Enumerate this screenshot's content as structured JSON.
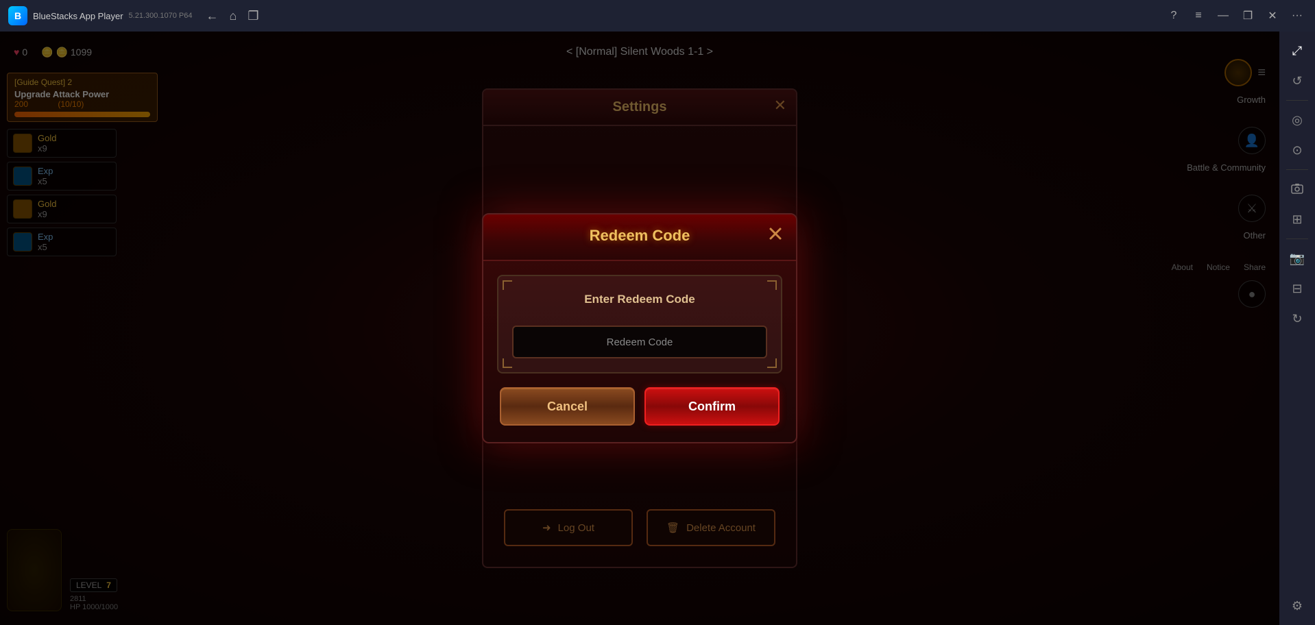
{
  "titleBar": {
    "appName": "BlueStacks App Player",
    "version": "5.21.300.1070  P64",
    "logoText": "B",
    "backBtn": "←",
    "homeBtn": "⌂",
    "copyBtn": "❐",
    "helpBtn": "?",
    "menuBtn": "≡",
    "minimizeBtn": "—",
    "restoreBtn": "❐",
    "closeBtn": "✕",
    "moreBtn": "···"
  },
  "sidebar": {
    "icons": [
      {
        "name": "resize-icon",
        "glyph": "⤢",
        "active": true
      },
      {
        "name": "rotate-icon",
        "glyph": "↺"
      },
      {
        "name": "camera-icon",
        "glyph": "◎"
      },
      {
        "name": "record-icon",
        "glyph": "⊙"
      },
      {
        "name": "screenshot-icon",
        "glyph": "📷"
      },
      {
        "name": "expand-icon",
        "glyph": "⊞"
      },
      {
        "name": "camera2-icon",
        "glyph": "📸"
      },
      {
        "name": "shrink-icon",
        "glyph": "⊟"
      },
      {
        "name": "sync-icon",
        "glyph": "↻"
      },
      {
        "name": "settings-icon",
        "glyph": "⚙"
      }
    ]
  },
  "gameHud": {
    "locationTitle": "< [Normal] Silent Woods 1-1 >",
    "hearts": "♥ 0",
    "coins": "🪙 1099",
    "questTitle": "[Guide Quest] 2",
    "questDesc": "Upgrade Attack Power",
    "questCount": "(10/10)",
    "questLevel": "200"
  },
  "lootItems": [
    {
      "name": "Gold",
      "count": "x9",
      "exp": "Exp",
      "expCount": "x5"
    },
    {
      "name": "Gold",
      "count": "x9",
      "exp": "Exp",
      "expCount": "x5"
    }
  ],
  "settingsModal": {
    "title": "Settings",
    "closeBtn": "✕",
    "logOutLabel": "Log Out",
    "deleteAccountLabel": "Delete Account"
  },
  "redeemModal": {
    "title": "Redeem Code",
    "closeBtn": "✕",
    "inputLabel": "Enter Redeem Code",
    "inputPlaceholder": "Redeem Code",
    "cancelLabel": "Cancel",
    "confirmLabel": "Confirm"
  },
  "gameRight": {
    "growthLabel": "Growth",
    "battleLabel": "Battle & Community",
    "otherLabel": "Other"
  },
  "playerInfo": {
    "level": "LEVEL",
    "levelNum": "7",
    "hp": "HP 1000/1000",
    "atk": "2811"
  }
}
